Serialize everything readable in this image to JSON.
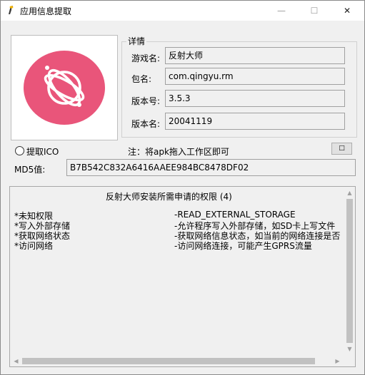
{
  "window": {
    "title": "应用信息提取",
    "minimize": "—",
    "maximize": "☐",
    "close": "✕"
  },
  "details": {
    "legend": "详情",
    "fields": [
      {
        "label": "游戏名:",
        "value": "反射大师"
      },
      {
        "label": "包名:",
        "value": "com.qingyu.rm"
      },
      {
        "label": "版本号:",
        "value": "3.5.3"
      },
      {
        "label": "版本名:",
        "value": "20041119"
      }
    ]
  },
  "logo": {
    "icon": "orbit-logo-icon",
    "bg_color": "#e9557a"
  },
  "options": {
    "extract_ico_label": "提取ICO",
    "note": "注：将apk拖入工作区即可",
    "small_button_label": "□"
  },
  "md5": {
    "label": "MD5值:",
    "value": "B7B542C832A6416AAEE984BC8478DF02"
  },
  "permissions": {
    "title": "反射大师安装所需申请的权限 (4)",
    "items": [
      {
        "name": "*未知权限",
        "desc": "-READ_EXTERNAL_STORAGE"
      },
      {
        "name": "*写入外部存储",
        "desc": "-允许程序写入外部存储，如SD卡上写文件"
      },
      {
        "name": "*获取网络状态",
        "desc": "-获取网络信息状态，如当前的网络连接是否"
      },
      {
        "name": "*访问网络",
        "desc": "-访问网络连接，可能产生GPRS流量"
      }
    ]
  }
}
